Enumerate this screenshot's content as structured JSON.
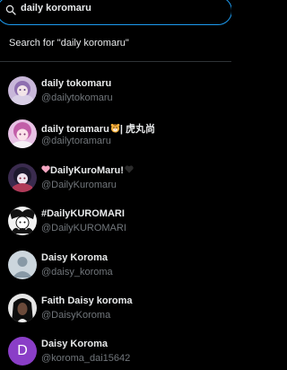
{
  "search": {
    "value": "daily koromaru",
    "search_for_text": "Search for \"daily koromaru\""
  },
  "results": [
    {
      "name": "daily tokomaru",
      "handle": "@dailytokomaru"
    },
    {
      "name_prefix": "daily toramaru",
      "name_suffix": "| 虎丸尚",
      "handle": "@dailytoramaru"
    },
    {
      "name_core": "DailyKuroMaru!",
      "handle": "@DailyKuromaru"
    },
    {
      "name": "#DailyKUROMARI",
      "handle": "@DailyKUROMARI"
    },
    {
      "name": "Daisy Koroma",
      "handle": "@daisy_koroma"
    },
    {
      "name": "Faith Daisy koroma",
      "handle": "@DaisyKoroma"
    },
    {
      "name": "Daisy Koroma",
      "handle": "@koroma_dai15642",
      "avatar_letter": "D"
    }
  ],
  "colors": {
    "accent": "#1d9bf0",
    "background": "#000000",
    "primary_text": "#e7e9ea",
    "secondary_text": "#71767b",
    "divider": "#2f3336",
    "letter_avatar_bg": "#8a3ec7",
    "pink_heart": "#f4a6c1",
    "black_heart": "#2b2b2b"
  },
  "icons": {
    "search": "search-icon",
    "tiger": "tiger-face-icon",
    "pink_heart": "pink-heart-icon",
    "black_heart": "black-heart-icon"
  }
}
